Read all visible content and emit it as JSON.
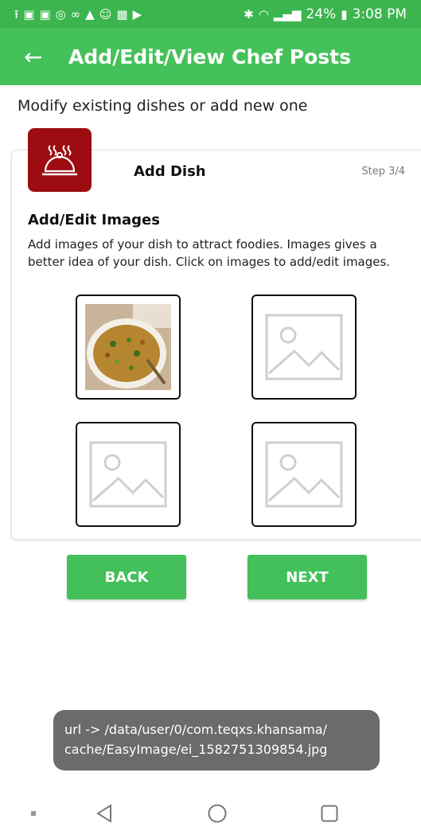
{
  "status_bar": {
    "time": "3:08 PM",
    "battery": "24%",
    "left_icons": [
      "upload-icon",
      "youtube-icon",
      "youtube-icon",
      "camera-icon",
      "voicemail-icon",
      "notification-icon",
      "smile-icon",
      "app-icon",
      "play-icon"
    ],
    "right_icons": [
      "bluetooth-icon",
      "wifi-icon",
      "signal-icon",
      "battery-icon"
    ]
  },
  "app_bar": {
    "title": "Add/Edit/View Chef Posts",
    "back_icon": "back-arrow-icon"
  },
  "page": {
    "subtitle": "Modify existing dishes or add new one"
  },
  "card": {
    "title": "Add Dish",
    "step": "Step 3/4",
    "section_title": "Add/Edit Images",
    "section_desc": "Add images of your dish to attract foodies. Images gives a better idea of your dish. Click on images to add/edit images.",
    "images": [
      {
        "name": "dish-image-1",
        "state": "filled"
      },
      {
        "name": "dish-image-2",
        "state": "empty"
      },
      {
        "name": "dish-image-3",
        "state": "empty"
      },
      {
        "name": "dish-image-4",
        "state": "empty"
      }
    ]
  },
  "buttons": {
    "back": "BACK",
    "next": "NEXT"
  },
  "toast": {
    "line1": "url -> /data/user/0/com.teqxs.khansama/",
    "line2": "cache/EasyImage/ei_1582751309854.jpg"
  },
  "colors": {
    "status_bar": "#3cb54f",
    "app_bar": "#45c15a",
    "button": "#43c05a",
    "badge": "#9c0c10",
    "toast": "#6b6b6b"
  },
  "nav_bar": [
    "recent-dot-icon",
    "back-triangle-icon",
    "home-circle-icon",
    "overview-square-icon"
  ]
}
